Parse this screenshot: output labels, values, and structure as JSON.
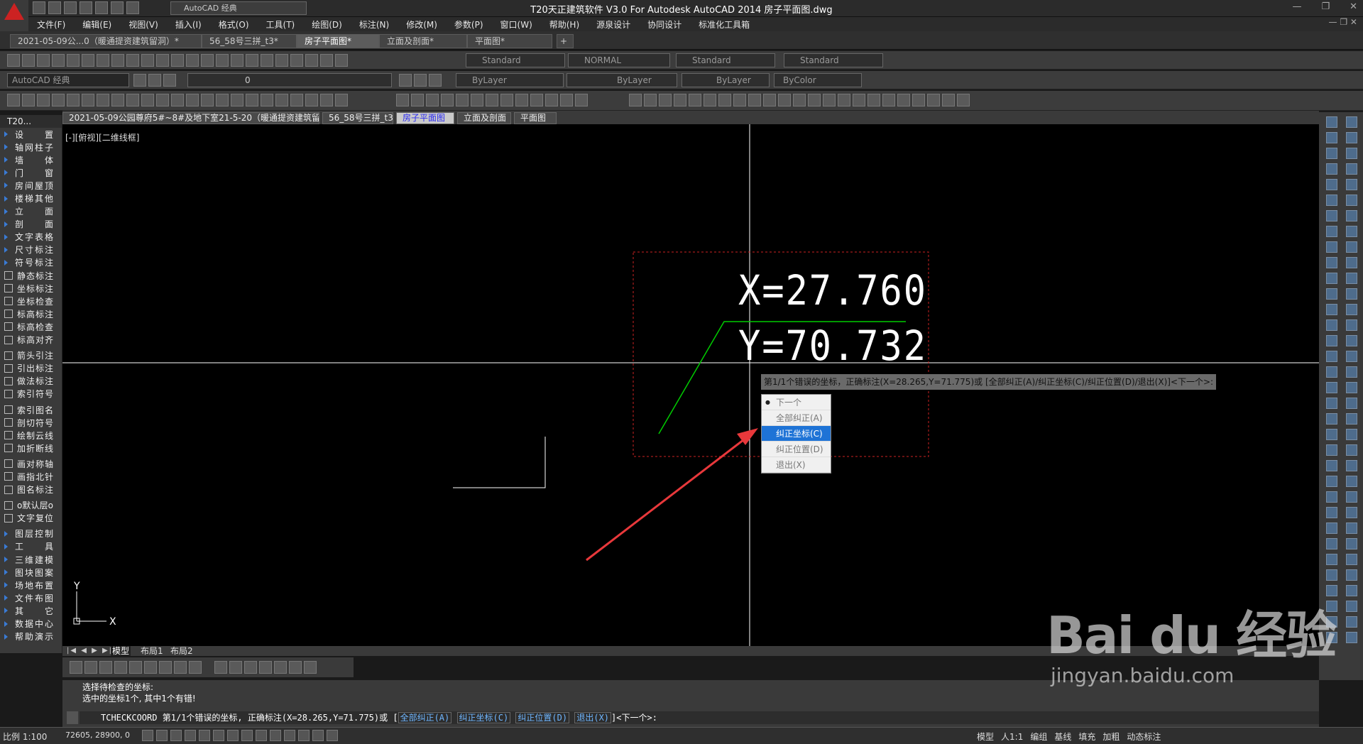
{
  "window": {
    "title": "T20天正建筑软件 V3.0 For Autodesk AutoCAD 2014    房子平面图.dwg",
    "workspace": "AutoCAD 经典"
  },
  "menu": [
    "文件(F)",
    "编辑(E)",
    "视图(V)",
    "插入(I)",
    "格式(O)",
    "工具(T)",
    "绘图(D)",
    "标注(N)",
    "修改(M)",
    "参数(P)",
    "窗口(W)",
    "帮助(H)",
    "源泉设计",
    "协同设计",
    "标准化工具箱"
  ],
  "doc_tabs": [
    {
      "label": "2021-05-09公...0（暖通提资建筑留洞）*",
      "active": false
    },
    {
      "label": "56_58号三拼_t3*",
      "active": false
    },
    {
      "label": "房子平面图*",
      "active": true
    },
    {
      "label": "立面及剖面*",
      "active": false
    },
    {
      "label": "平面图*",
      "active": false
    }
  ],
  "styles_toolbar": {
    "text_style": "Standard",
    "dim_style": "NORMAL",
    "table_style": "Standard",
    "mleader_style": "Standard"
  },
  "layers_toolbar": {
    "workspace": "AutoCAD 经典",
    "current_layer": "0",
    "color": "ByLayer",
    "linetype": "ByLayer",
    "lineweight": "ByLayer",
    "plotstyle": "ByColor"
  },
  "side_panel": {
    "title": "T20...",
    "items": [
      {
        "label": "设　　置",
        "kind": "arrow"
      },
      {
        "label": "轴网柱子",
        "kind": "arrow"
      },
      {
        "label": "墙　　体",
        "kind": "arrow"
      },
      {
        "label": "门　　窗",
        "kind": "arrow"
      },
      {
        "label": "房间屋顶",
        "kind": "arrow"
      },
      {
        "label": "楼梯其他",
        "kind": "arrow"
      },
      {
        "label": "立　　面",
        "kind": "arrow"
      },
      {
        "label": "剖　　面",
        "kind": "arrow"
      },
      {
        "label": "文字表格",
        "kind": "arrow"
      },
      {
        "label": "尺寸标注",
        "kind": "arrow"
      },
      {
        "label": "符号标注",
        "kind": "arrow"
      },
      {
        "label": "静态标注",
        "kind": "icon"
      },
      {
        "label": "坐标标注",
        "kind": "icon"
      },
      {
        "label": "坐标检查",
        "kind": "icon"
      },
      {
        "label": "标高标注",
        "kind": "icon"
      },
      {
        "label": "标高检查",
        "kind": "icon"
      },
      {
        "label": "标高对齐",
        "kind": "icon"
      },
      {
        "label": "",
        "kind": "spacer"
      },
      {
        "label": "箭头引注",
        "kind": "icon"
      },
      {
        "label": "引出标注",
        "kind": "icon"
      },
      {
        "label": "做法标注",
        "kind": "icon"
      },
      {
        "label": "索引符号",
        "kind": "icon"
      },
      {
        "label": "",
        "kind": "spacer"
      },
      {
        "label": "索引图名",
        "kind": "icon"
      },
      {
        "label": "剖切符号",
        "kind": "icon"
      },
      {
        "label": "绘制云线",
        "kind": "icon"
      },
      {
        "label": "加折断线",
        "kind": "icon"
      },
      {
        "label": "",
        "kind": "spacer"
      },
      {
        "label": "画对称轴",
        "kind": "icon"
      },
      {
        "label": "画指北针",
        "kind": "icon"
      },
      {
        "label": "图名标注",
        "kind": "icon"
      },
      {
        "label": "",
        "kind": "spacer"
      },
      {
        "label": "o默认层o",
        "kind": "icon"
      },
      {
        "label": "文字复位",
        "kind": "icon"
      },
      {
        "label": "",
        "kind": "spacer"
      },
      {
        "label": "图层控制",
        "kind": "arrow"
      },
      {
        "label": "工　　具",
        "kind": "arrow"
      },
      {
        "label": "三维建模",
        "kind": "arrow"
      },
      {
        "label": "图块图案",
        "kind": "arrow"
      },
      {
        "label": "场地布置",
        "kind": "arrow"
      },
      {
        "label": "文件布图",
        "kind": "arrow"
      },
      {
        "label": "其　　它",
        "kind": "arrow"
      },
      {
        "label": "数据中心",
        "kind": "arrow"
      },
      {
        "label": "帮助演示",
        "kind": "arrow"
      }
    ]
  },
  "drawing_tabs": [
    {
      "label": "2021-05-09公园尊府5#~8#及地下室21-5-20（暖通提资建筑留洞）",
      "active": false
    },
    {
      "label": "56_58号三拼_t3",
      "active": false
    },
    {
      "label": "房子平面图",
      "active": true
    },
    {
      "label": "立面及剖面",
      "active": false
    },
    {
      "label": "平面图",
      "active": false
    }
  ],
  "canvas": {
    "view_label": "[-][俯视][二维线框]",
    "coord_x": "X=27.760",
    "coord_y": "Y=70.732",
    "prompt_tip": "第1/1个错误的坐标，正确标注(X=28.265,Y=71.775)或 [全部纠正(A)/纠正坐标(C)/纠正位置(D)/退出(X)]<下一个>:",
    "ucs_x": "X",
    "ucs_y": "Y",
    "colors": {
      "crosshair": "#ffffff",
      "leader": "#00cc00",
      "selection": "#cc2222",
      "arrow": "#e8383b"
    }
  },
  "context_menu": [
    {
      "label": "下一个",
      "bullet": true,
      "selected": false
    },
    {
      "label": "全部纠正(A)",
      "bullet": false,
      "selected": false
    },
    {
      "label": "纠正坐标(C)",
      "bullet": false,
      "selected": true
    },
    {
      "label": "纠正位置(D)",
      "bullet": false,
      "selected": false
    },
    {
      "label": "退出(X)",
      "bullet": false,
      "selected": false
    }
  ],
  "layout_tabs": [
    "模型",
    "布局1",
    "布局2"
  ],
  "command": {
    "history": [
      "选择待检查的坐标:",
      "选中的坐标1个, 其中1个有错!"
    ],
    "current_cmd": "TCHECKCOORD",
    "current_text": "第1/1个错误的坐标, 正确标注(X=28.265,Y=71.775)或",
    "options": [
      "全部纠正(A)",
      "纠正坐标(C)",
      "纠正位置(D)",
      "退出(X)"
    ],
    "default": "]<下一个>:"
  },
  "status": {
    "scale": "比例 1:100",
    "coords": "72605, 28900, 0",
    "right": [
      "模型",
      "人1:1",
      "编组",
      "基线",
      "填充",
      "加粗",
      "动态标注"
    ]
  },
  "watermark": {
    "main": "Bai du 经验",
    "sub": "jingyan.baidu.com"
  }
}
